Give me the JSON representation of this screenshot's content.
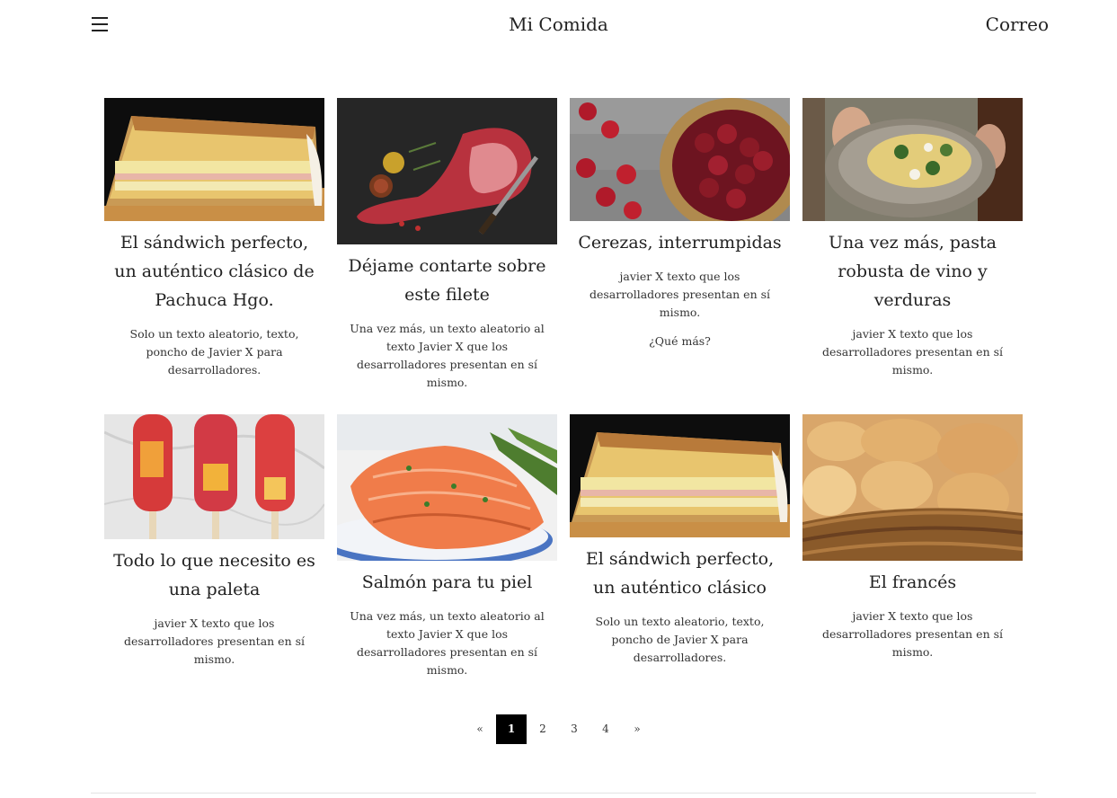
{
  "header": {
    "title": "Mi Comida",
    "mail_label": "Correo",
    "menu_icon": "hamburger-menu-icon"
  },
  "cards": [
    {
      "image": "toasted-ham-cheese-sandwich",
      "title": "El sándwich perfecto, un auténtico clásico de Pachuca Hgo.",
      "text": "Solo un texto aleatorio, texto, poncho de Javier X para desarrolladores.",
      "extra": ""
    },
    {
      "image": "raw-tomahawk-steak",
      "title": "Déjame contarte sobre este filete",
      "text": "Una vez más, un texto aleatorio al texto Javier X que los desarrolladores presentan en sí mismo.",
      "extra": ""
    },
    {
      "image": "cherries-basket",
      "title": "Cerezas, interrumpidas",
      "text": "javier X texto que los desarrolladores presentan en sí mismo.",
      "extra": "¿Qué más?"
    },
    {
      "image": "pasta-bowl",
      "title": "Una vez más, pasta robusta de vino y verduras",
      "text": "javier X texto que los desarrolladores presentan en sí mismo.",
      "extra": ""
    },
    {
      "image": "fruit-popsicles",
      "title": "Todo lo que necesito es una paleta",
      "text": "javier X texto que los desarrolladores presentan en sí mismo.",
      "extra": ""
    },
    {
      "image": "grilled-salmon",
      "title": "Salmón para tu piel",
      "text": "Una vez más, un texto aleatorio al texto Javier X que los desarrolladores presentan en sí mismo.",
      "extra": ""
    },
    {
      "image": "toasted-ham-cheese-sandwich",
      "title": "El sándwich perfecto, un auténtico clásico",
      "text": "Solo un texto aleatorio, texto, poncho de Javier X para desarrolladores.",
      "extra": ""
    },
    {
      "image": "bread-basket",
      "title": "El francés",
      "text": "javier X texto que los desarrolladores presentan en sí mismo.",
      "extra": ""
    }
  ],
  "pagination": {
    "prev": "«",
    "pages": [
      "1",
      "2",
      "3",
      "4"
    ],
    "current": "1",
    "next": "»"
  }
}
